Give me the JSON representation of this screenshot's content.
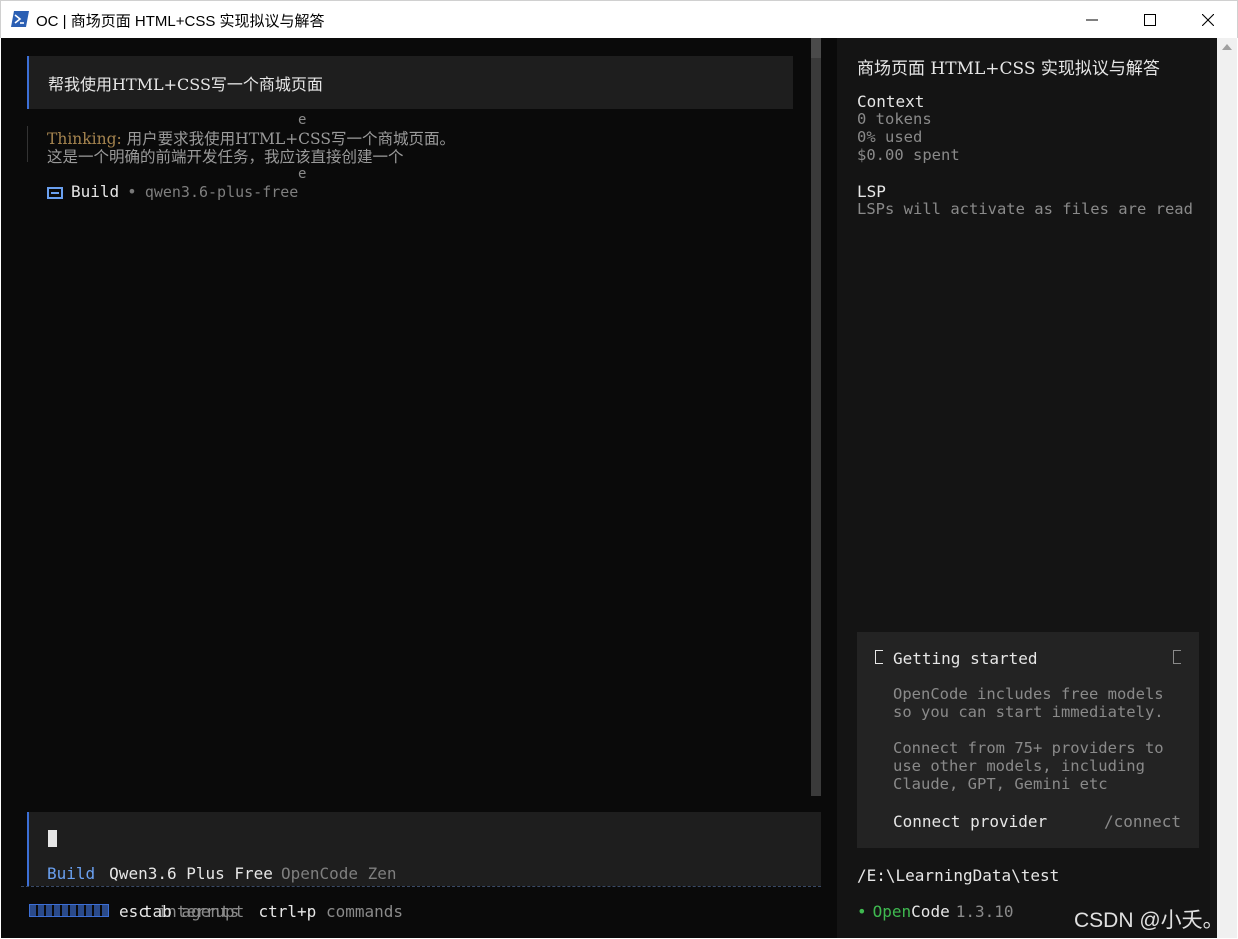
{
  "window": {
    "title": "OC | 商场页面 HTML+CSS 实现拟议与解答",
    "minimize_label": "minimize",
    "maximize_label": "maximize",
    "close_label": "close"
  },
  "conversation": {
    "user_message": "帮我使用HTML+CSS写一个商城页面",
    "stray_char_1": "e",
    "thinking_label": "Thinking:",
    "thinking_line1": " 用户要求我使用HTML+CSS写一个商城页面。",
    "thinking_line2": "这是一个明确的前端开发任务，我应该直接创建一个",
    "stray_char_2": "e",
    "build_label": "Build",
    "build_sep": "•",
    "build_model": "qwen3.6-plus-free"
  },
  "input": {
    "agent": "Build",
    "model": "Qwen3.6 Plus Free",
    "provider": "OpenCode Zen"
  },
  "footer": {
    "esc_key": "esc",
    "esc_action": "interrupt",
    "tab_key": "tab",
    "tab_action": "agents",
    "ctrl_key": "ctrl+p",
    "ctrl_action": "commands"
  },
  "sidebar": {
    "title": "商场页面 HTML+CSS 实现拟议与解答",
    "context_heading": "Context",
    "tokens": "0 tokens",
    "used": "0% used",
    "spent": "$0.00 spent",
    "lsp_heading": "LSP",
    "lsp_text": "LSPs will activate as files are read",
    "getting_started": {
      "title": "Getting started",
      "line1": "OpenCode includes free models",
      "line2": "so you can start immediately.",
      "line3": "Connect from 75+ providers to",
      "line4": "use other models, including",
      "line5": "Claude, GPT, Gemini etc",
      "connect_label": "Connect provider",
      "connect_cmd": "/connect"
    },
    "path": "/E:\\LearningData\\test",
    "version_dot": "•",
    "version_open": "Open",
    "version_code": "Code",
    "version_number": "1.3.10"
  },
  "watermark": "CSDN @小夭。",
  "colors": {
    "accent": "#3c6fd6",
    "thinking": "#a5844f",
    "green": "#3fb950",
    "background": "#0a0a0a"
  }
}
